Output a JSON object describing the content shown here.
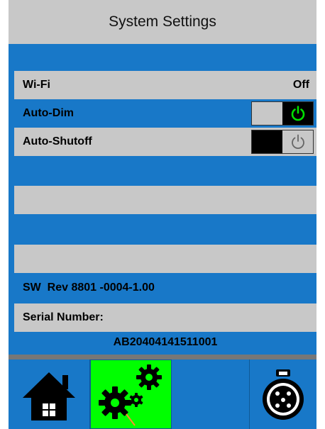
{
  "title": "System Settings",
  "settings": {
    "wifi": {
      "label": "Wi-Fi",
      "value": "Off"
    },
    "auto_dim": {
      "label": "Auto-Dim",
      "state": "on"
    },
    "auto_shutoff": {
      "label": "Auto-Shutoff",
      "state": "off"
    }
  },
  "sw_rev": "SW  Rev 8801 -0004-1.00",
  "serial": {
    "label": "Serial Number:",
    "value": "AB20404141511001"
  },
  "tabs": [
    {
      "id": "home",
      "icon": "home-icon",
      "active": false
    },
    {
      "id": "settings",
      "icon": "gears-icon",
      "active": true
    },
    {
      "id": "blank",
      "icon": "",
      "active": false
    },
    {
      "id": "connector",
      "icon": "xlr-connector-icon",
      "active": false
    }
  ],
  "colors": {
    "background_blue": "#1878c8",
    "panel_gray": "#c8c8c8",
    "active_green": "#00ff00",
    "power_on_green": "#00e000"
  }
}
